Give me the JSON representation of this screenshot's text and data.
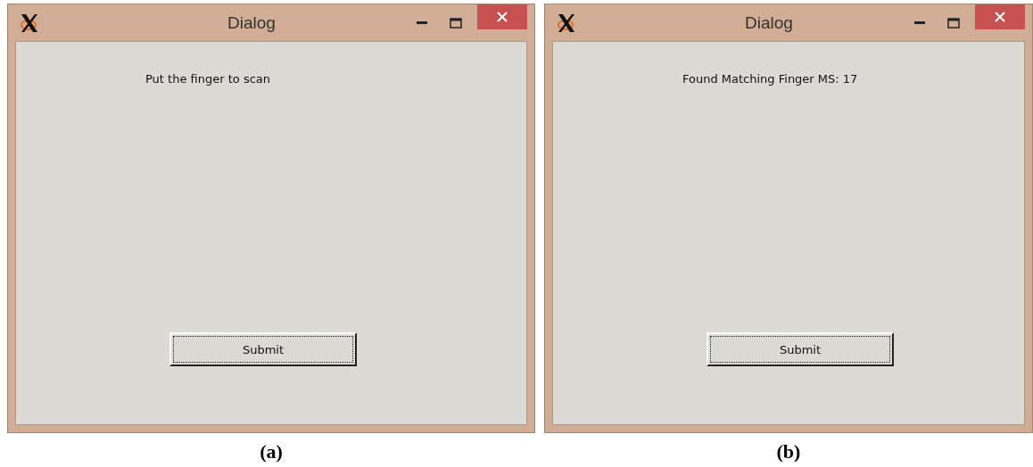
{
  "windows": [
    {
      "title": "Dialog",
      "message": "Put the finger to scan",
      "button": "Submit",
      "caption": "(a)"
    },
    {
      "title": "Dialog",
      "message": "Found Matching Finger MS: 17",
      "button": "Submit",
      "caption": "(b)"
    }
  ]
}
